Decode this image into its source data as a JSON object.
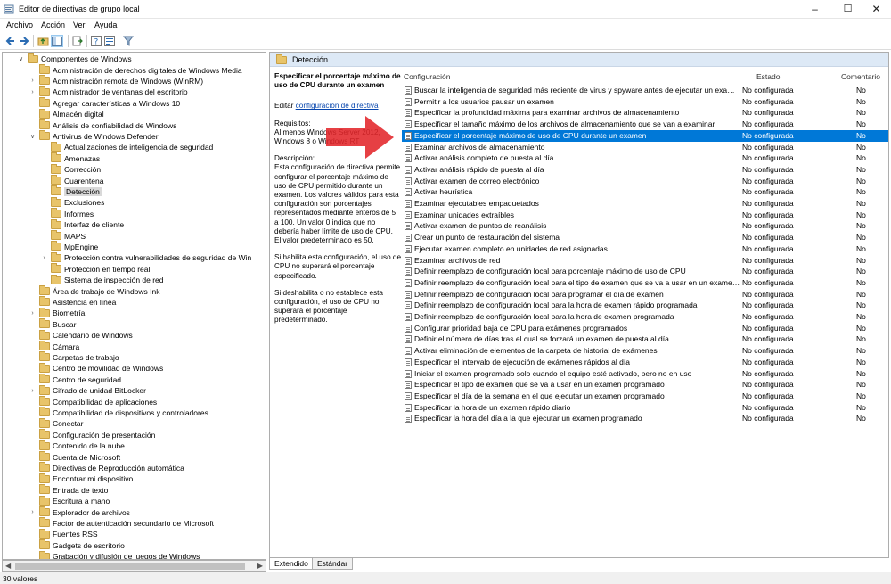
{
  "window": {
    "title": "Editor de directivas de grupo local"
  },
  "menu": [
    "Archivo",
    "Acción",
    "Ver",
    "Ayuda"
  ],
  "toolbar": {
    "icons": [
      "back-icon",
      "forward-icon",
      "folder-up-icon",
      "show-hide-tree-icon",
      "export-list-icon",
      "help-icon",
      "properties-icon",
      "filter-icon"
    ]
  },
  "tree": {
    "items": [
      {
        "label": "Componentes de Windows",
        "level": 0,
        "expander": "down"
      },
      {
        "label": "Administración de derechos digitales de Windows Media",
        "level": 1,
        "expander": ""
      },
      {
        "label": "Administración remota de Windows (WinRM)",
        "level": 1,
        "expander": "right"
      },
      {
        "label": "Administrador de ventanas del escritorio",
        "level": 1,
        "expander": "right"
      },
      {
        "label": "Agregar características a Windows 10",
        "level": 1,
        "expander": ""
      },
      {
        "label": "Almacén digital",
        "level": 1,
        "expander": ""
      },
      {
        "label": "Análisis de confiabilidad de Windows",
        "level": 1,
        "expander": ""
      },
      {
        "label": "Antivirus de Windows Defender",
        "level": 1,
        "expander": "down"
      },
      {
        "label": "Actualizaciones de inteligencia de seguridad",
        "level": 2,
        "expander": ""
      },
      {
        "label": "Amenazas",
        "level": 2,
        "expander": ""
      },
      {
        "label": "Corrección",
        "level": 2,
        "expander": ""
      },
      {
        "label": "Cuarentena",
        "level": 2,
        "expander": ""
      },
      {
        "label": "Detección",
        "level": 2,
        "expander": "",
        "selected": true
      },
      {
        "label": "Exclusiones",
        "level": 2,
        "expander": ""
      },
      {
        "label": "Informes",
        "level": 2,
        "expander": ""
      },
      {
        "label": "Interfaz de cliente",
        "level": 2,
        "expander": ""
      },
      {
        "label": "MAPS",
        "level": 2,
        "expander": ""
      },
      {
        "label": "MpEngine",
        "level": 2,
        "expander": ""
      },
      {
        "label": "Protección contra vulnerabilidades de seguridad de Win",
        "level": 2,
        "expander": "right"
      },
      {
        "label": "Protección en tiempo real",
        "level": 2,
        "expander": ""
      },
      {
        "label": "Sistema de inspección de red",
        "level": 2,
        "expander": ""
      },
      {
        "label": "Área de trabajo de Windows Ink",
        "level": 1,
        "expander": ""
      },
      {
        "label": "Asistencia en línea",
        "level": 1,
        "expander": ""
      },
      {
        "label": "Biometría",
        "level": 1,
        "expander": "right"
      },
      {
        "label": "Buscar",
        "level": 1,
        "expander": ""
      },
      {
        "label": "Calendario de Windows",
        "level": 1,
        "expander": ""
      },
      {
        "label": "Cámara",
        "level": 1,
        "expander": ""
      },
      {
        "label": "Carpetas de trabajo",
        "level": 1,
        "expander": ""
      },
      {
        "label": "Centro de movilidad de Windows",
        "level": 1,
        "expander": ""
      },
      {
        "label": "Centro de seguridad",
        "level": 1,
        "expander": ""
      },
      {
        "label": "Cifrado de unidad BitLocker",
        "level": 1,
        "expander": "right"
      },
      {
        "label": "Compatibilidad de aplicaciones",
        "level": 1,
        "expander": ""
      },
      {
        "label": "Compatibilidad de dispositivos y controladores",
        "level": 1,
        "expander": ""
      },
      {
        "label": "Conectar",
        "level": 1,
        "expander": ""
      },
      {
        "label": "Configuración de presentación",
        "level": 1,
        "expander": ""
      },
      {
        "label": "Contenido de la nube",
        "level": 1,
        "expander": ""
      },
      {
        "label": "Cuenta de Microsoft",
        "level": 1,
        "expander": ""
      },
      {
        "label": "Directivas de Reproducción automática",
        "level": 1,
        "expander": ""
      },
      {
        "label": "Encontrar mi dispositivo",
        "level": 1,
        "expander": ""
      },
      {
        "label": "Entrada de texto",
        "level": 1,
        "expander": ""
      },
      {
        "label": "Escritura a mano",
        "level": 1,
        "expander": ""
      },
      {
        "label": "Explorador de archivos",
        "level": 1,
        "expander": "right"
      },
      {
        "label": "Factor de autenticación secundario de Microsoft",
        "level": 1,
        "expander": ""
      },
      {
        "label": "Fuentes RSS",
        "level": 1,
        "expander": ""
      },
      {
        "label": "Gadgets de escritorio",
        "level": 1,
        "expander": ""
      },
      {
        "label": "Grabación y difusión de juegos de Windows",
        "level": 1,
        "expander": ""
      }
    ]
  },
  "panel": {
    "title": "Detección"
  },
  "description": {
    "title": "Especificar el porcentaje máximo de uso de CPU durante un examen",
    "edit_prefix": "Editar",
    "edit_link": "configuración de directiva",
    "requirements_label": "Requisitos:",
    "requirements": "Al menos Windows Server 2012, Windows 8 o Windows RT",
    "description_label": "Descripción:",
    "description": "Esta configuración de directiva permite configurar el porcentaje máximo de uso de CPU permitido durante un examen. Los valores válidos para esta configuración son porcentajes representados mediante enteros de 5 a 100. Un valor 0 indica que no debería haber límite de uso de CPU. El valor predeterminado es 50.",
    "enabled_text": "Si habilita esta configuración, el uso de CPU no superará el porcentaje especificado.",
    "disabled_text": "Si deshabilita o no establece esta configuración, el uso de CPU no superará el porcentaje predeterminado."
  },
  "list": {
    "columns": {
      "name": "Configuración",
      "state": "Estado",
      "comment": "Comentario"
    },
    "rows": [
      {
        "name": "Buscar la inteligencia de seguridad más reciente de virus y spyware antes de ejecutar un examen p...",
        "state": "No configurada",
        "comment": "No"
      },
      {
        "name": "Permitir a los usuarios pausar un examen",
        "state": "No configurada",
        "comment": "No"
      },
      {
        "name": "Especificar la profundidad máxima para examinar archivos de almacenamiento",
        "state": "No configurada",
        "comment": "No"
      },
      {
        "name": "Especificar el tamaño máximo de los archivos de almacenamiento que se van a examinar",
        "state": "No configurada",
        "comment": "No"
      },
      {
        "name": "Especificar el porcentaje máximo de uso de CPU durante un examen",
        "state": "No configurada",
        "comment": "No",
        "selected": true
      },
      {
        "name": "Examinar archivos de almacenamiento",
        "state": "No configurada",
        "comment": "No"
      },
      {
        "name": "Activar análisis completo de puesta al día",
        "state": "No configurada",
        "comment": "No"
      },
      {
        "name": "Activar análisis rápido de puesta al día",
        "state": "No configurada",
        "comment": "No"
      },
      {
        "name": "Activar examen de correo electrónico",
        "state": "No configurada",
        "comment": "No"
      },
      {
        "name": "Activar heurística",
        "state": "No configurada",
        "comment": "No"
      },
      {
        "name": "Examinar ejecutables empaquetados",
        "state": "No configurada",
        "comment": "No"
      },
      {
        "name": "Examinar unidades extraíbles",
        "state": "No configurada",
        "comment": "No"
      },
      {
        "name": "Activar examen de puntos de reanálisis",
        "state": "No configurada",
        "comment": "No"
      },
      {
        "name": "Crear un punto de restauración del sistema",
        "state": "No configurada",
        "comment": "No"
      },
      {
        "name": "Ejecutar examen completo en unidades de red asignadas",
        "state": "No configurada",
        "comment": "No"
      },
      {
        "name": "Examinar archivos de red",
        "state": "No configurada",
        "comment": "No"
      },
      {
        "name": "Definir reemplazo de configuración local para porcentaje máximo de uso de CPU",
        "state": "No configurada",
        "comment": "No"
      },
      {
        "name": "Definir reemplazo de configuración local para el tipo de examen que se va a usar en un examen pr...",
        "state": "No configurada",
        "comment": "No"
      },
      {
        "name": "Definir reemplazo de configuración local para programar el día de examen",
        "state": "No configurada",
        "comment": "No"
      },
      {
        "name": "Definir reemplazo de configuración local para la hora de examen rápido programada",
        "state": "No configurada",
        "comment": "No"
      },
      {
        "name": "Definir reemplazo de configuración local para la hora de examen programada",
        "state": "No configurada",
        "comment": "No"
      },
      {
        "name": "Configurar prioridad baja de CPU para exámenes programados",
        "state": "No configurada",
        "comment": "No"
      },
      {
        "name": "Definir el número de días tras el cual se forzará un examen de puesta al día",
        "state": "No configurada",
        "comment": "No"
      },
      {
        "name": "Activar eliminación de elementos de la carpeta de historial de exámenes",
        "state": "No configurada",
        "comment": "No"
      },
      {
        "name": "Especificar el intervalo de ejecución de exámenes rápidos al día",
        "state": "No configurada",
        "comment": "No"
      },
      {
        "name": "Iniciar el examen programado solo cuando el equipo esté activado, pero no en uso",
        "state": "No configurada",
        "comment": "No"
      },
      {
        "name": "Especificar el tipo de examen que se va a usar en un examen programado",
        "state": "No configurada",
        "comment": "No"
      },
      {
        "name": "Especificar el día de la semana en el que ejecutar un examen programado",
        "state": "No configurada",
        "comment": "No"
      },
      {
        "name": "Especificar la hora de un examen rápido diario",
        "state": "No configurada",
        "comment": "No"
      },
      {
        "name": "Especificar la hora del día a la que ejecutar un examen programado",
        "state": "No configurada",
        "comment": "No"
      }
    ]
  },
  "tabs": [
    {
      "label": "Extendido",
      "active": true
    },
    {
      "label": "Estándar",
      "active": false
    }
  ],
  "status": {
    "text": "30 valores"
  },
  "colors": {
    "selection": "#0078d7",
    "panel_header": "#dde9f6",
    "arrow": "#e3262a"
  }
}
